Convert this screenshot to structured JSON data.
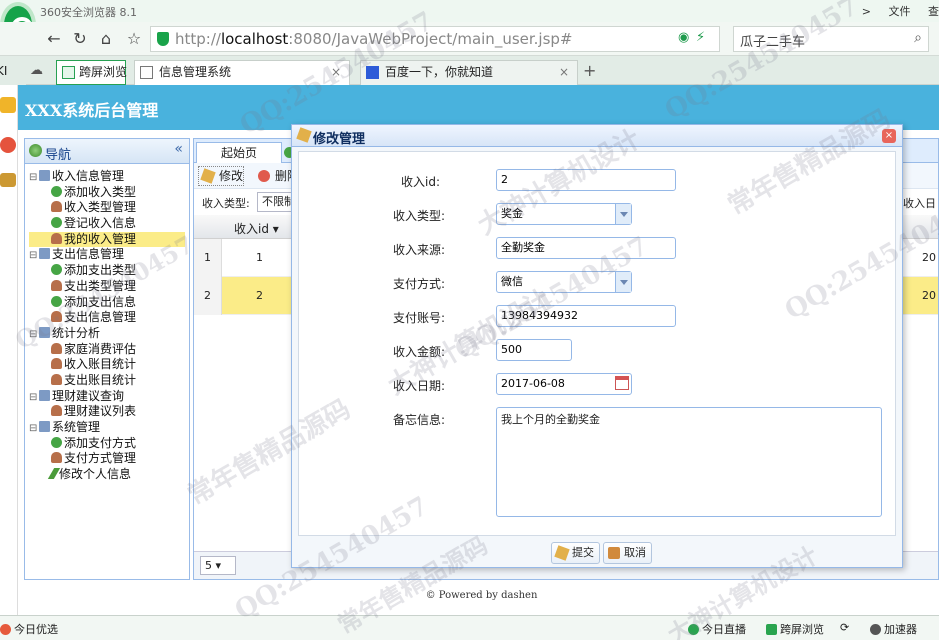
{
  "browser": {
    "brand": "360安全浏览器 8.1",
    "menu": [
      ">",
      "文件",
      "查"
    ],
    "url_prefix": "http://",
    "url_host": "localhost",
    "url_rest": ":8080/JavaWebProject/main_user.jsp#",
    "search_text": "瓜子二手车",
    "tabs": [
      {
        "label": "跨屏浏览"
      },
      {
        "label": "信息管理系统",
        "close": "×"
      },
      {
        "label": "百度一下，你就知道",
        "close": "×"
      }
    ],
    "new_tab": "+"
  },
  "app": {
    "title": "XXX系统后台管理",
    "footer": "© Powered by dashen"
  },
  "nav": {
    "title": "导航",
    "collapse": "«",
    "groups": [
      {
        "label": "收入信息管理",
        "items": [
          "添加收入类型",
          "收入类型管理",
          "登记收入信息",
          "我的收入管理"
        ]
      },
      {
        "label": "支出信息管理",
        "items": [
          "添加支出类型",
          "支出类型管理",
          "添加支出信息",
          "支出信息管理"
        ]
      },
      {
        "label": "统计分析",
        "items": [
          "家庭消费评估",
          "收入账目统计",
          "支出账目统计"
        ]
      },
      {
        "label": "理财建议查询",
        "items": [
          "理财建议列表"
        ]
      },
      {
        "label": "系统管理",
        "items": [
          "添加支付方式",
          "支付方式管理",
          "修改个人信息"
        ]
      }
    ],
    "expander": "⊟"
  },
  "content": {
    "tab_label": "起始页",
    "toolbar": {
      "edit": "修改",
      "delete": "删除"
    },
    "filter_label": "收入类型:",
    "filter_value": "不限制",
    "filter_right": "收入日",
    "column_id": "收入id",
    "rows": [
      {
        "num": "1",
        "id": "1",
        "right": "20"
      },
      {
        "num": "2",
        "id": "2",
        "right": "20"
      }
    ],
    "page_size": "5"
  },
  "dialog": {
    "title": "修改管理",
    "close": "×",
    "fields": [
      {
        "label": "收入id:",
        "value": "2"
      },
      {
        "label": "收入类型:",
        "value": "奖金"
      },
      {
        "label": "收入来源:",
        "value": "全勤奖金"
      },
      {
        "label": "支付方式:",
        "value": "微信"
      },
      {
        "label": "支付账号:",
        "value": "13984394932"
      },
      {
        "label": "收入金额:",
        "value": "500"
      },
      {
        "label": "收入日期:",
        "value": "2017-06-08"
      },
      {
        "label": "备忘信息:",
        "value": "我上个月的全勤奖金"
      }
    ],
    "submit": "提交",
    "cancel": "取消"
  },
  "status": {
    "left": "今日优选",
    "items": [
      "今日直播",
      "跨屏浏览",
      "加速器"
    ]
  },
  "watermarks": [
    "QQ:254540457",
    "常年售精品源码",
    "大神计算机设计"
  ],
  "colors": {
    "header": "#49b2dd",
    "selected_row": "#fbec88",
    "border": "#99bbe8"
  }
}
